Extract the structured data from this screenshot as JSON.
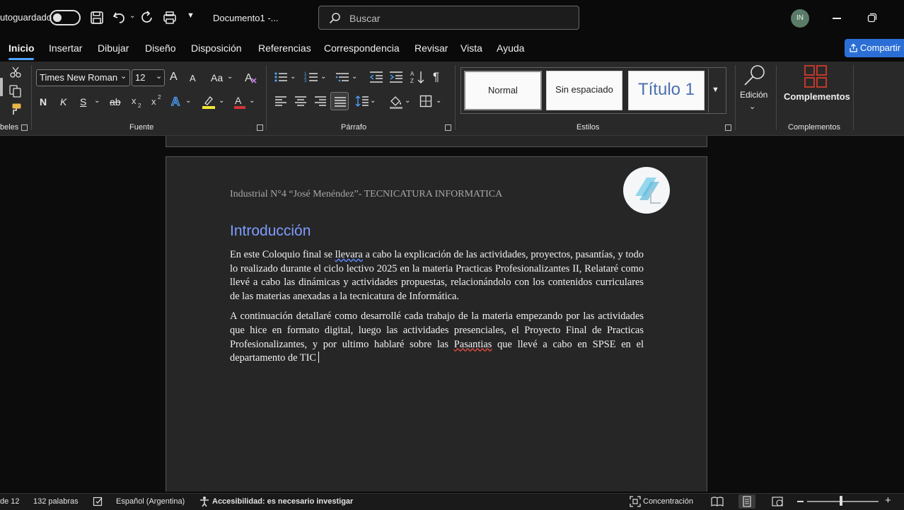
{
  "titlebar": {
    "autosave_label": "utoguardado",
    "doc_title": "Documento1  -...",
    "search_placeholder": "Buscar",
    "avatar_initials": "IN"
  },
  "tabs": [
    "Inicio",
    "Insertar",
    "Dibujar",
    "Diseño",
    "Disposición",
    "Referencias",
    "Correspondencia",
    "Revisar",
    "Vista",
    "Ayuda"
  ],
  "share_label": "Compartir",
  "ribbon": {
    "clipboard_label": "beles",
    "font": {
      "name": "Times New Roman",
      "size": "12",
      "label": "Fuente",
      "bold": "N",
      "italic": "K",
      "underline": "S",
      "strikethrough": "ab",
      "case_label": "Aa",
      "grow": "A",
      "shrink": "A"
    },
    "paragraph_label": "Párrafo",
    "styles": {
      "label": "Estilos",
      "items": [
        "Normal",
        "Sin espaciado",
        "Título 1"
      ]
    },
    "editing_label": "Edición",
    "addins_button": "Complementos",
    "addins_label": "Complementos"
  },
  "document": {
    "header": "Industrial N°4 “José Menéndez”- TECNICATURA INFORMATICA",
    "heading": "Introducción",
    "p1_a": "En este Coloquio final se ",
    "p1_flag": "llevara",
    "p1_b": " a cabo la explicación de las actividades, proyectos, pasantías, y todo lo realizado durante el ciclo lectivo 2025 en la materia Practicas Profesionalizantes II, Relataré como llevé a cabo las dinámicas y actividades propuestas, relacionándolo con los contenidos curriculares de las materias anexadas a la tecnicatura de Informática.",
    "p2_a": "A continuación detallaré como desarrollé cada trabajo de la materia empezando por las actividades que hice en formato digital, luego las actividades presenciales, el Proyecto Final de Practicas Profesionalizantes, y por ultimo hablaré sobre las ",
    "p2_flag": "Pasantias",
    "p2_b": " que llevé a cabo en SPSE en el departamento de TIC"
  },
  "statusbar": {
    "page": "de 12",
    "words": "132 palabras",
    "language": "Español (Argentina)",
    "accessibility": "Accesibilidad: es necesario investigar",
    "focus": "Concentración"
  },
  "colors": {
    "accent": "#4ea3ff",
    "heading": "#7f9cff",
    "share": "#2b6fd6"
  }
}
